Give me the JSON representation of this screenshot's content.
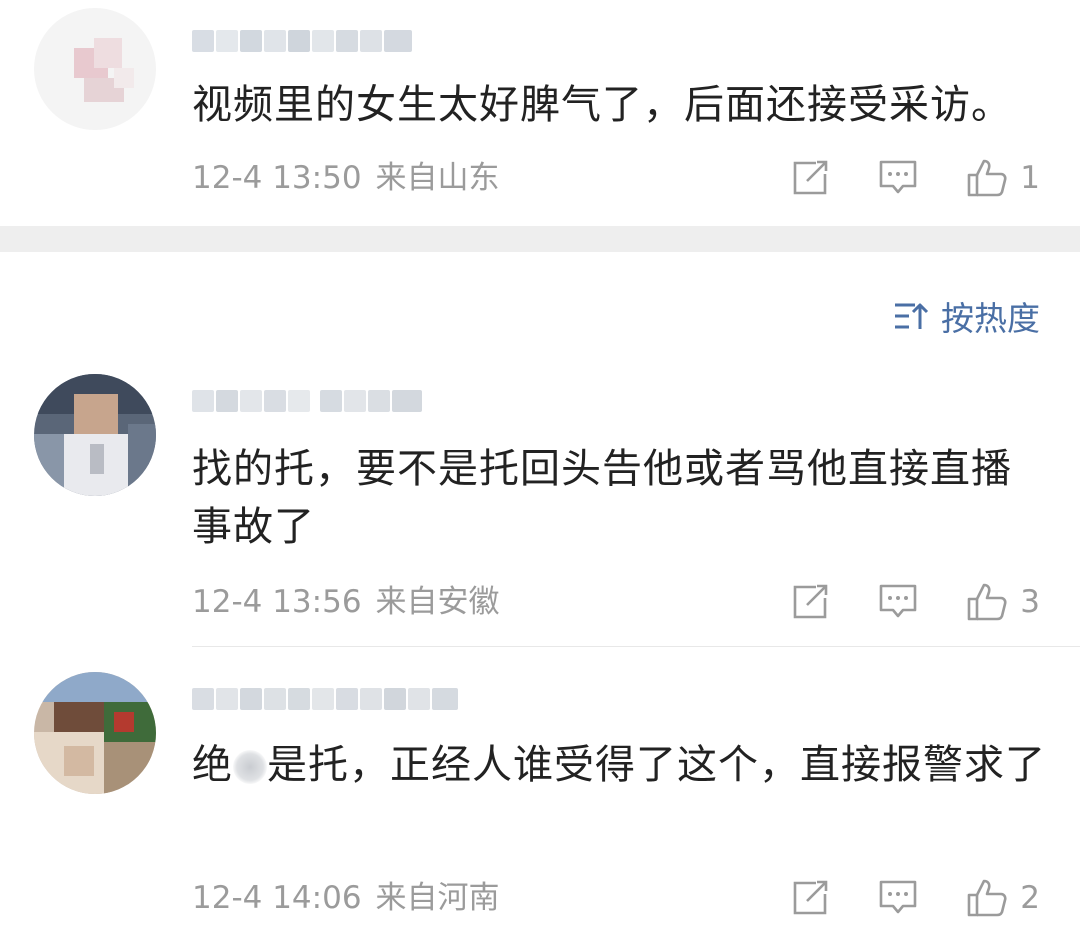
{
  "comments_top": [
    {
      "text": "视频里的女生太好脾气了，后面还接受采访。",
      "time": "12-4 13:50",
      "location": "来自山东",
      "likes": "1"
    }
  ],
  "sort": {
    "label": "按热度",
    "icon": "sort-icon"
  },
  "comments": [
    {
      "text": "找的托，要不是托回头告他或者骂他直接直播事故了",
      "time": "12-4 13:56",
      "location": "来自安徽",
      "likes": "3"
    },
    {
      "text_before": "绝",
      "text_after": "是托，正经人谁受得了这个，直接报警求了",
      "time": "12-4 14:06",
      "location": "来自河南",
      "likes": "2"
    }
  ],
  "icons": {
    "share": "share-icon",
    "reply": "comment-icon",
    "like": "thumbs-up-icon"
  },
  "colors": {
    "text": "#222222",
    "meta": "#9b9b9b",
    "accent": "#4a6fa5",
    "band": "#eeeeee"
  }
}
